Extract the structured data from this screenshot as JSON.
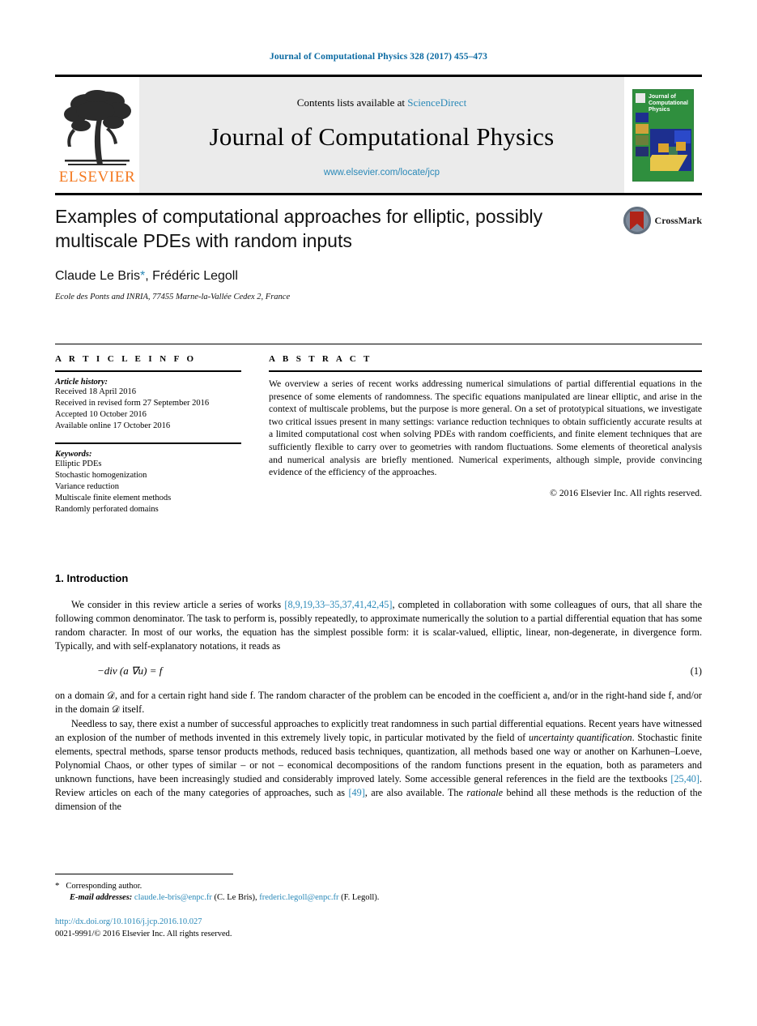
{
  "running_head": "Journal of Computational Physics 328 (2017) 455–473",
  "masthead": {
    "contents_prefix": "Contents lists available at ",
    "sciencedirect": "ScienceDirect",
    "journal_name": "Journal of Computational Physics",
    "journal_url": "www.elsevier.com/locate/jcp",
    "publisher_wordmark": "ELSEVIER",
    "cover_title": "Journal of Computational Physics",
    "accent_color": "#2a89b8",
    "elsevier_orange": "#F47920",
    "cover_green": "#2f8f3e"
  },
  "article": {
    "title": "Examples of computational approaches for elliptic, possibly multiscale PDEs with random inputs",
    "authors": "Claude Le Bris",
    "author_star": "*",
    "authors_rest": ", Frédéric Legoll",
    "affiliation": "Ecole des Ponts and INRIA, 77455 Marne-la-Vallée Cedex 2, France",
    "crossmark_label": "CrossMark"
  },
  "info": {
    "heading": "A R T I C L E   I N F O",
    "history_label": "Article history:",
    "history": [
      "Received 18 April 2016",
      "Received in revised form 27 September 2016",
      "Accepted 10 October 2016",
      "Available online 17 October 2016"
    ],
    "keywords_label": "Keywords:",
    "keywords": [
      "Elliptic PDEs",
      "Stochastic homogenization",
      "Variance reduction",
      "Multiscale finite element methods",
      "Randomly perforated domains"
    ]
  },
  "abstract": {
    "heading": "A B S T R A C T",
    "text": "We overview a series of recent works addressing numerical simulations of partial differential equations in the presence of some elements of randomness. The specific equations manipulated are linear elliptic, and arise in the context of multiscale problems, but the purpose is more general. On a set of prototypical situations, we investigate two critical issues present in many settings: variance reduction techniques to obtain sufficiently accurate results at a limited computational cost when solving PDEs with random coefficients, and finite element techniques that are sufficiently flexible to carry over to geometries with random fluctuations. Some elements of theoretical analysis and numerical analysis are briefly mentioned. Numerical experiments, although simple, provide convincing evidence of the efficiency of the approaches.",
    "copyright": "© 2016 Elsevier Inc. All rights reserved."
  },
  "body": {
    "section_number_title": "1. Introduction",
    "para1_a": "We consider in this review article a series of works ",
    "para1_cite": "[8,9,19,33–35,37,41,42,45]",
    "para1_b": ", completed in collaboration with some colleagues of ours, that all share the following common denominator. The task to perform is, possibly repeatedly, to approximate numerically the solution to a partial differential equation that has some random character. In most of our works, the equation has the simplest possible form: it is scalar-valued, elliptic, linear, non-degenerate, in divergence form. Typically, and with self-explanatory notations, it reads as",
    "equation": "−div (a ∇u) = f",
    "equation_number": "(1)",
    "para2": "on a domain 𝒟, and for a certain right hand side f. The random character of the problem can be encoded in the coefficient a, and/or in the right-hand side f, and/or in the domain 𝒟 itself.",
    "para3_a": "Needless to say, there exist a number of successful approaches to explicitly treat randomness in such partial differential equations. Recent years have witnessed an explosion of the number of methods invented in this extremely lively topic, in particular motivated by the field of ",
    "para3_italic1": "uncertainty quantification",
    "para3_b": ". Stochastic finite elements, spectral methods, sparse tensor products methods, reduced basis techniques, quantization, all methods based one way or another on Karhunen–Loeve, Polynomial Chaos, or other types of similar – or not – economical decompositions of the random functions present in the equation, both as parameters and unknown functions, have been increasingly studied and considerably improved lately. Some accessible general references in the field are the textbooks ",
    "para3_cite1": "[25,40]",
    "para3_c": ". Review articles on each of the many categories of approaches, such as ",
    "para3_cite2": "[49]",
    "para3_d": ", are also available. The ",
    "para3_italic2": "rationale",
    "para3_e": " behind all these methods is the reduction of the dimension of the"
  },
  "footnotes": {
    "star": "*",
    "corresponding": "Corresponding author.",
    "email_label": "E-mail addresses:",
    "email1": "claude.le-bris@enpc.fr",
    "email1_owner": "(C. Le Bris),",
    "email2": "frederic.legoll@enpc.fr",
    "email2_owner": "(F. Legoll).",
    "doi": "http://dx.doi.org/10.1016/j.jcp.2016.10.027",
    "issn_copyright": "0021-9991/© 2016 Elsevier Inc. All rights reserved."
  }
}
